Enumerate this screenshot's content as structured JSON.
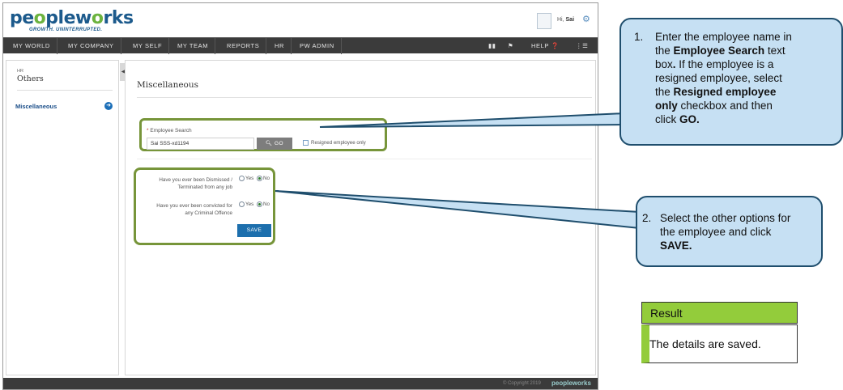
{
  "header": {
    "logo_prefix": "pe",
    "logo_o": "o",
    "logo_mid": "ple",
    "logo_w": "w",
    "logo_o2": "o",
    "logo_suffix": "rks",
    "tagline": "GROWTH. UNINTERRUPTED.",
    "greeting": "Hi,",
    "user_name": "Sai"
  },
  "nav": {
    "items": [
      "MY WORLD",
      "MY COMPANY",
      "MY SELF",
      "MY TEAM",
      "REPORTS",
      "HR",
      "PW ADMIN"
    ],
    "help_label": "HELP"
  },
  "sidebar": {
    "section_small": "HR",
    "section_title": "Others",
    "item_label": "Miscellaneous"
  },
  "main": {
    "page_title": "Miscellaneous",
    "employee_search_label": "Employee Search",
    "employee_search_value": "Sai SSS-xd1194",
    "go_label": "GO",
    "resigned_label": "Resigned employee only",
    "q1_line1": "Have you ever been Dismissed /",
    "q1_line2": "Terminated from any job",
    "q2_line1": "Have you ever been convicted for",
    "q2_line2": "any Criminal Offence",
    "yes_label": "Yes",
    "no_label": "No",
    "q1_selected": "No",
    "q2_selected": "No",
    "save_label": "SAVE"
  },
  "footer": {
    "copyright": "© Copyright 2019",
    "logo": "peopleworks"
  },
  "callout1": {
    "number": "1.",
    "line1": "Enter the employee name in",
    "line2_pre": "the ",
    "line2_bold": "Employee Search",
    "line2_post": "  text",
    "line3_pre": "box",
    "line3_bold": ".",
    "line3_post": " If the employee is a",
    "line4": "resigned employee, select",
    "line5_pre": "the ",
    "line5_bold": "Resigned employee",
    "line6_bold": "only",
    "line6_post": "  checkbox and then",
    "line7_pre": "click ",
    "line7_bold": "GO."
  },
  "callout2": {
    "number": "2.",
    "line1": "Select the other options for",
    "line2": "the employee and click",
    "line3_bold": "SAVE."
  },
  "result": {
    "heading": "Result",
    "text": "The details are saved."
  },
  "colors": {
    "nav_bg": "#3b3b3b",
    "brand_blue": "#1c5a8c",
    "brand_green": "#6cb33f",
    "highlight_green": "#77953a",
    "callout_fill": "#c6e0f3",
    "callout_border": "#1f4e6d",
    "result_green": "#93cc3b",
    "save_button": "#1d6fad"
  }
}
